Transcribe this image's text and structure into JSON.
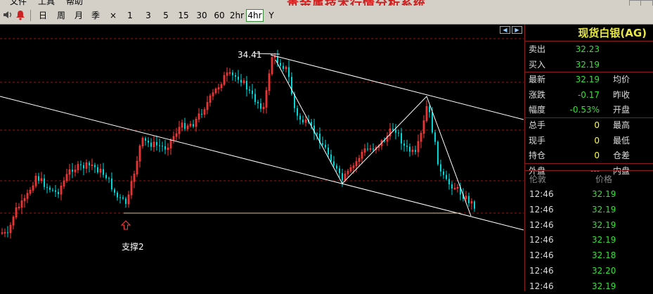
{
  "window": {
    "title": "贵金属技术行情分析系统",
    "menu": [
      "文件",
      "工具",
      "帮助"
    ]
  },
  "toolbar": {
    "periods": [
      "日",
      "周",
      "月",
      "季",
      "×",
      "1",
      "3",
      "5",
      "15",
      "30",
      "60",
      "2hr",
      "4hr",
      "Y"
    ],
    "active_period": "4hr"
  },
  "chart": {
    "peak_label": "34.41",
    "support_label": "支撑2",
    "colors": {
      "up": "#ff3a3a",
      "down": "#00d8d8",
      "trend": "#ffffff",
      "grid": "#8b1a1a",
      "support": "#e0c0a0"
    }
  },
  "panel": {
    "title": "现货白银(AG)",
    "quotes": [
      {
        "label": "卖出",
        "value": "32.23",
        "color": "green",
        "label2": ""
      },
      {
        "label": "买入",
        "value": "32.19",
        "color": "green",
        "label2": ""
      },
      {
        "label": "最新",
        "value": "32.19",
        "color": "green",
        "label2": "均价"
      },
      {
        "label": "涨跌",
        "value": "-0.17",
        "color": "green",
        "label2": "昨收"
      },
      {
        "label": "幅度",
        "value": "-0.53%",
        "color": "green",
        "label2": "开盘"
      },
      {
        "label": "总手",
        "value": "0",
        "color": "yellow",
        "label2": "最高"
      },
      {
        "label": "现手",
        "value": "0",
        "color": "yellow",
        "label2": "最低"
      },
      {
        "label": "持仓",
        "value": "0",
        "color": "yellow",
        "label2": "仓差"
      },
      {
        "label": "外盘",
        "value": "---",
        "color": "red",
        "label2": "内盘"
      }
    ],
    "ticks_header": {
      "time": "伦敦",
      "price": "价格"
    },
    "ticks": [
      {
        "time": "12:46",
        "price": "32.19",
        "color": "green"
      },
      {
        "time": "12:46",
        "price": "32.19",
        "color": "green"
      },
      {
        "time": "12:46",
        "price": "32.19",
        "color": "green"
      },
      {
        "time": "12:46",
        "price": "32.19",
        "color": "green"
      },
      {
        "time": "12:46",
        "price": "32.18",
        "color": "green"
      },
      {
        "time": "12:46",
        "price": "32.20",
        "color": "green"
      },
      {
        "time": "12:46",
        "price": "32.19",
        "color": "green"
      }
    ]
  }
}
